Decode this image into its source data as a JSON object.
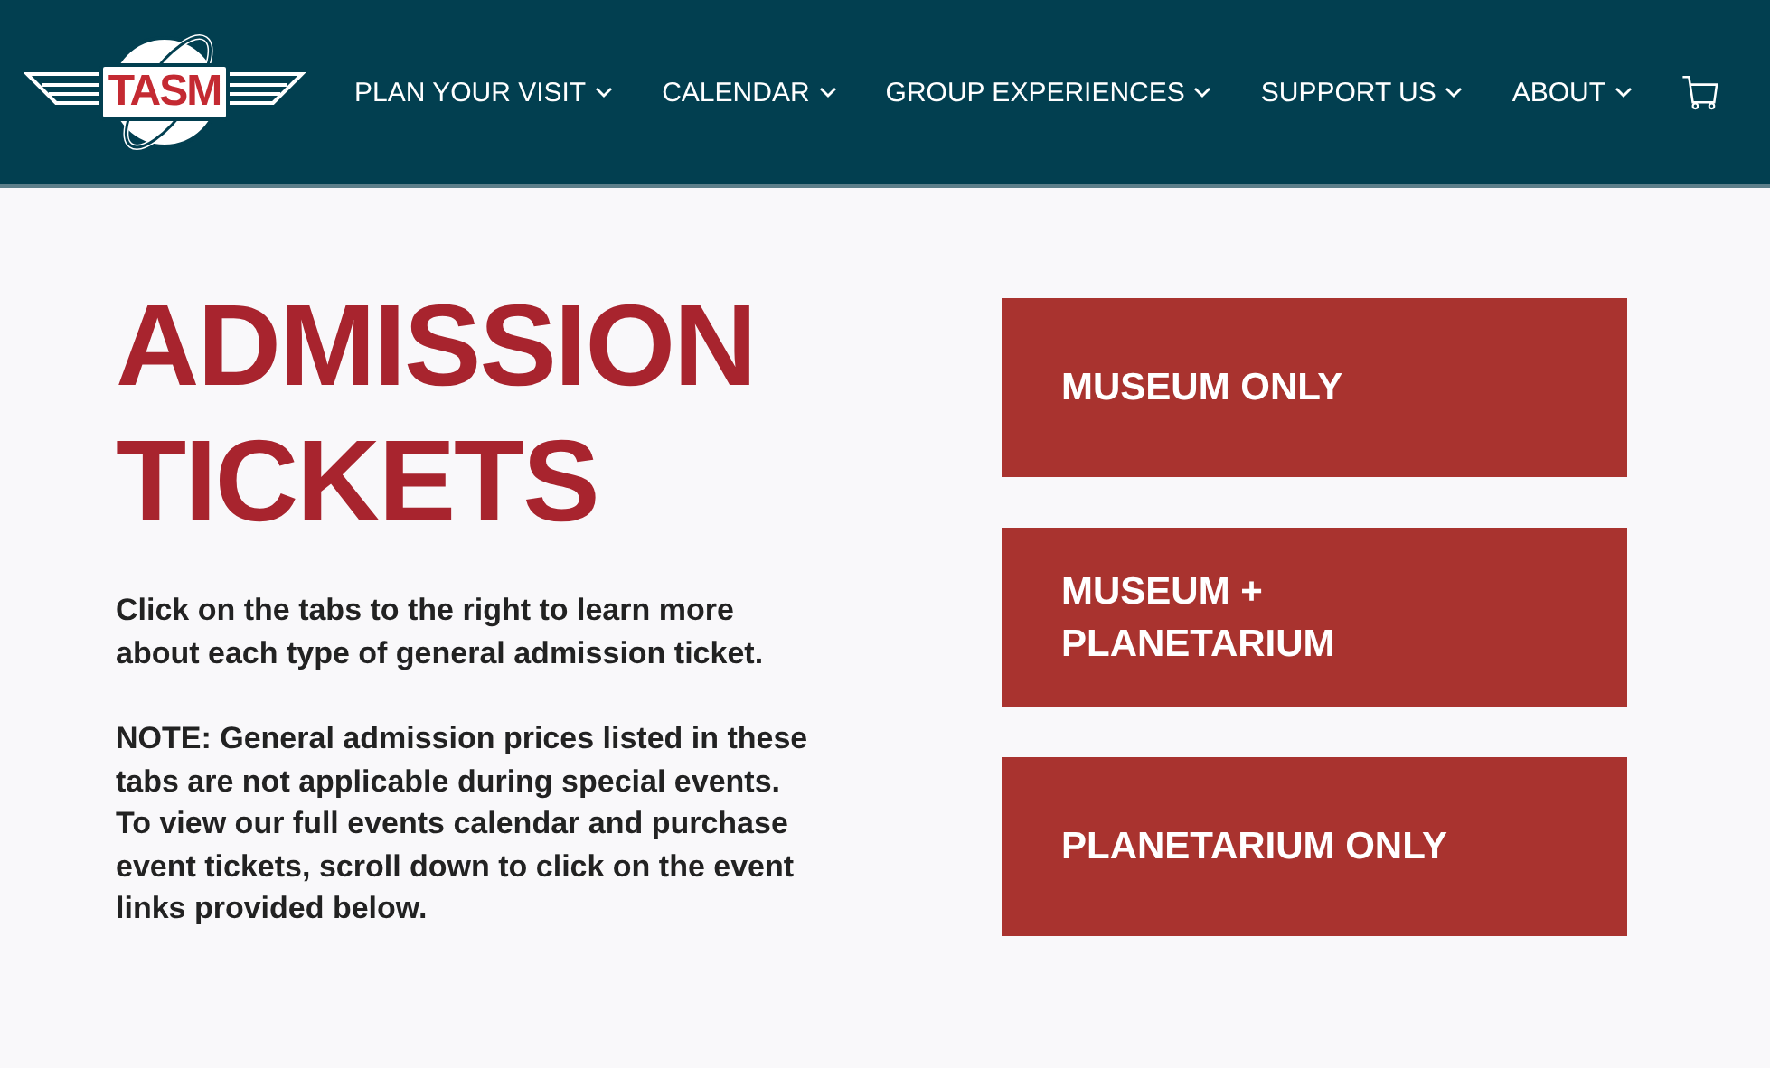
{
  "header": {
    "logo": {
      "text": "TASM"
    },
    "nav": [
      {
        "label": "PLAN YOUR VISIT"
      },
      {
        "label": "CALENDAR"
      },
      {
        "label": "GROUP EXPERIENCES"
      },
      {
        "label": "SUPPORT US"
      },
      {
        "label": "ABOUT"
      }
    ]
  },
  "main": {
    "title": [
      "ADMISSION",
      "TICKETS"
    ],
    "paragraphs": [
      "Click on the tabs to the right to learn more about each type of general admission ticket.",
      "NOTE: General admission prices listed in these tabs are not applicable during special events. To view our full events calendar and purchase event tickets, scroll down to click on the event links provided below."
    ],
    "tabs": [
      {
        "label": "MUSEUM ONLY"
      },
      {
        "label": "MUSEUM + PLANETARIUM"
      },
      {
        "label": "PLANETARIUM ONLY"
      }
    ]
  }
}
